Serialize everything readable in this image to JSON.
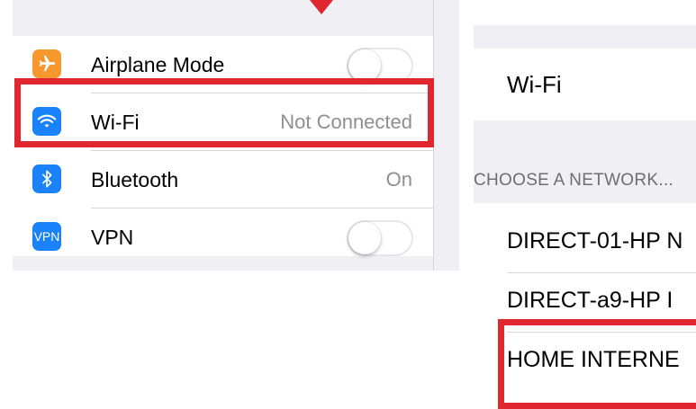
{
  "settings": {
    "items": [
      {
        "label": "Airplane Mode",
        "icon": "airplane-icon",
        "icon_color": "#f7982e",
        "control": "toggle-off"
      },
      {
        "label": "Wi-Fi",
        "value": "Not Connected",
        "icon": "wifi-icon",
        "icon_color": "#1a82fb"
      },
      {
        "label": "Bluetooth",
        "value": "On",
        "icon": "bluetooth-icon",
        "icon_color": "#1a82fb"
      },
      {
        "label": "VPN",
        "icon": "vpn-icon",
        "icon_color": "#1a82fb",
        "icon_text": "VPN",
        "control": "toggle-off"
      }
    ]
  },
  "wifi_screen": {
    "wifi_label": "Wi-Fi",
    "section_header": "CHOOSE A NETWORK...",
    "networks": [
      "DIRECT-01-HP N",
      "DIRECT-a9-HP I",
      "HOME INTERNE"
    ]
  },
  "colors": {
    "highlight": "#e0262f",
    "background_gray": "#efeff4"
  }
}
